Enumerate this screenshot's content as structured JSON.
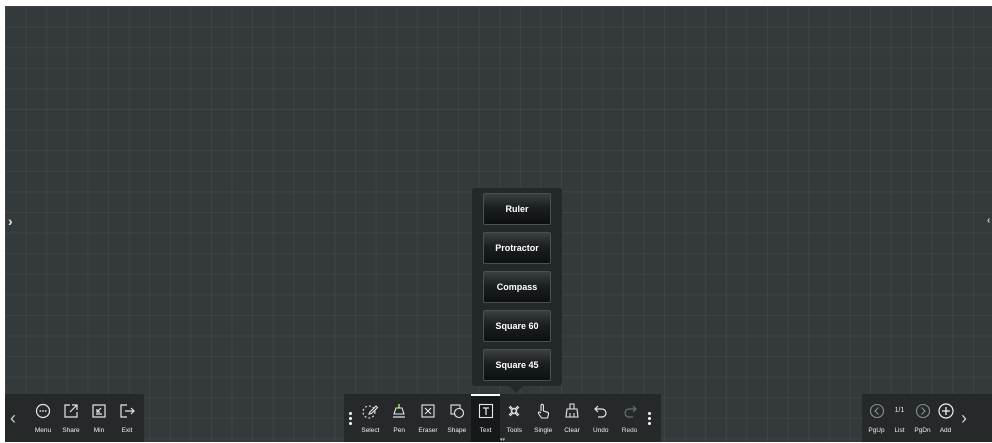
{
  "colors": {
    "board": "#343a3b",
    "toolbar": "#25292a",
    "active_tool_bg": "#15191a",
    "popup": "#23282a",
    "pen_accent": "#6fbf3a",
    "text": "#f0f0f0"
  },
  "board": {
    "left_handle": "›",
    "right_handle": "‹"
  },
  "left_toolbar": {
    "prev_arrow": "‹",
    "items": [
      {
        "label": "Menu",
        "icon": "menu-dots-icon"
      },
      {
        "label": "Share",
        "icon": "share-icon"
      },
      {
        "label": "Min",
        "icon": "minimize-icon"
      },
      {
        "label": "Exit",
        "icon": "exit-icon"
      }
    ]
  },
  "center_toolbar": {
    "active": "Text",
    "items": [
      {
        "label": "Select",
        "icon": "lasso-select-icon"
      },
      {
        "label": "Pen",
        "icon": "pen-icon"
      },
      {
        "label": "Eraser",
        "icon": "eraser-icon"
      },
      {
        "label": "Shape",
        "icon": "shape-icon"
      },
      {
        "label": "Text",
        "icon": "text-box-icon"
      },
      {
        "label": "Tools",
        "icon": "tools-icon"
      },
      {
        "label": "Single",
        "icon": "hand-touch-icon"
      },
      {
        "label": "Clear",
        "icon": "clear-icon"
      },
      {
        "label": "Undo",
        "icon": "undo-icon"
      },
      {
        "label": "Redo",
        "icon": "redo-icon"
      }
    ]
  },
  "tools_popup": {
    "items": [
      "Ruler",
      "Protractor",
      "Compass",
      "Square 60",
      "Square 45"
    ]
  },
  "right_toolbar": {
    "next_arrow": "›",
    "page_indicator": "1/1",
    "items": [
      {
        "label": "PgUp",
        "icon": "page-up-icon"
      },
      {
        "label": "List",
        "icon": "page-list-icon"
      },
      {
        "label": "PgDn",
        "icon": "page-down-icon"
      },
      {
        "label": "Add",
        "icon": "add-page-icon"
      }
    ]
  }
}
